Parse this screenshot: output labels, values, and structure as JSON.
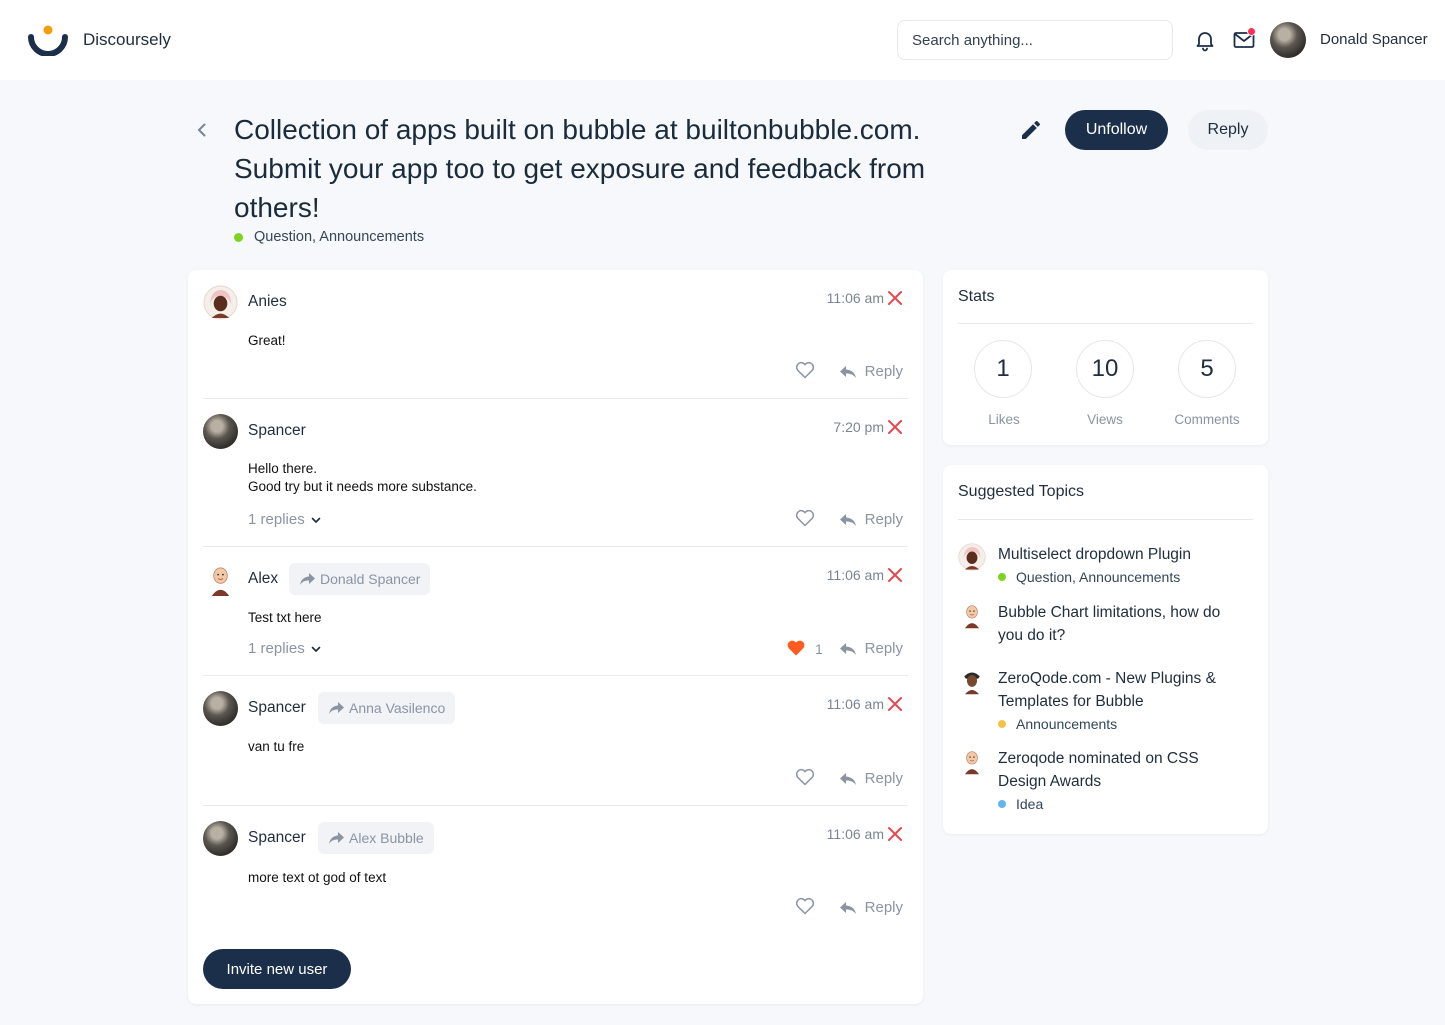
{
  "colors": {
    "primary": "#1b2f4b",
    "accent_orange": "#f59e0b",
    "like_red": "#ff5a1f",
    "delete_red": "#e5484d",
    "tag_green": "#7ed321",
    "tag_yellow": "#f6c244",
    "tag_blue": "#63b3ed"
  },
  "header": {
    "brand": "Discoursely",
    "search_placeholder": "Search anything...",
    "user_name": "Donald Spancer"
  },
  "topic": {
    "title": "Collection of apps built on bubble at builtonbubble.com. Submit your app too to get exposure and feedback from others!",
    "tags": "Question, Announcements",
    "unfollow_label": "Unfollow",
    "reply_label": "Reply"
  },
  "comments": [
    {
      "author": "Anies",
      "reply_to": "",
      "time": "11:06 am",
      "body": [
        "Great!"
      ],
      "replies": "",
      "likes": "",
      "liked": false,
      "reply_label": "Reply"
    },
    {
      "author": "Spancer",
      "reply_to": "",
      "time": "7:20 pm",
      "body": [
        "Hello there.",
        "Good try but it needs more substance."
      ],
      "replies": "1 replies",
      "likes": "",
      "liked": false,
      "reply_label": "Reply"
    },
    {
      "author": "Alex",
      "reply_to": "Donald Spancer",
      "time": "11:06 am",
      "body": [
        "Test txt here"
      ],
      "replies": "1 replies",
      "likes": "1",
      "liked": true,
      "reply_label": "Reply"
    },
    {
      "author": "Spancer",
      "reply_to": "Anna Vasilenco",
      "time": "11:06 am",
      "body": [
        "van tu fre"
      ],
      "replies": "",
      "likes": "",
      "liked": false,
      "reply_label": "Reply"
    },
    {
      "author": "Spancer",
      "reply_to": "Alex Bubble",
      "time": "11:06 am",
      "body": [
        "more text ot god of text"
      ],
      "replies": "",
      "likes": "",
      "liked": false,
      "reply_label": "Reply"
    }
  ],
  "invite_label": "Invite new user",
  "stats": {
    "title": "Stats",
    "items": [
      {
        "value": "1",
        "label": "Likes"
      },
      {
        "value": "10",
        "label": "Views"
      },
      {
        "value": "5",
        "label": "Comments"
      }
    ]
  },
  "suggested": {
    "title": "Suggested Topics",
    "items": [
      {
        "title": "Multiselect dropdown Plugin",
        "tags": "Question, Announcements",
        "tag_color": "#7ed321"
      },
      {
        "title": "Bubble Chart limitations, how do you do it?",
        "tags": "",
        "tag_color": ""
      },
      {
        "title": "ZeroQode.com - New Plugins & Templates for Bubble",
        "tags": "Announcements",
        "tag_color": "#f6c244"
      },
      {
        "title": "Zeroqode nominated on CSS Design Awards",
        "tags": "Idea",
        "tag_color": "#63b3ed"
      }
    ]
  }
}
